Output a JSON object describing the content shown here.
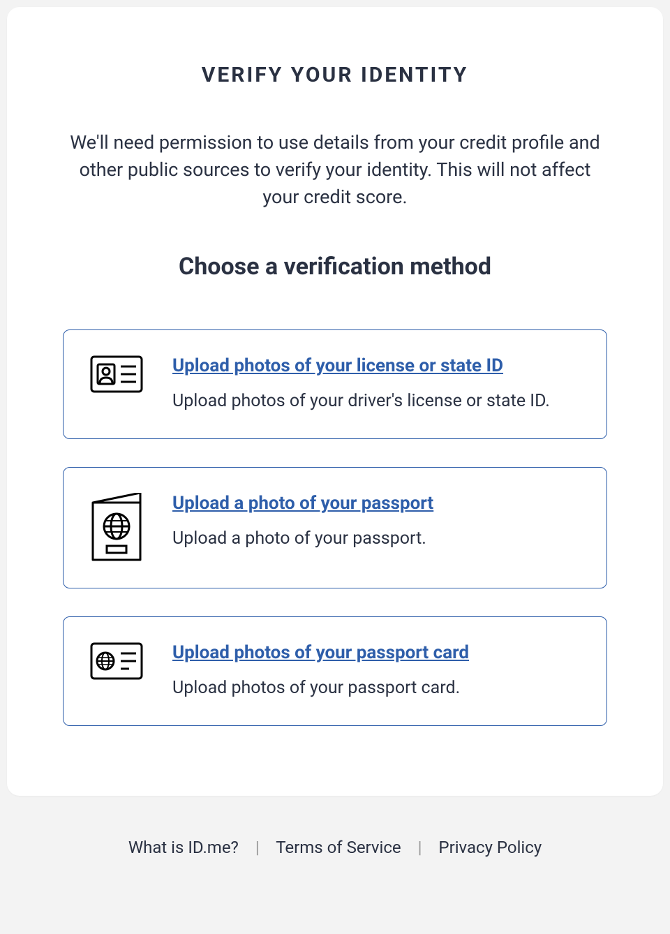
{
  "title": "VERIFY YOUR IDENTITY",
  "intro": "We'll need permission to use details from your credit profile and other public sources to verify your identity. This will not affect your credit score.",
  "subtitle": "Choose a verification method",
  "methods": [
    {
      "title": "Upload photos of your license or state ID",
      "desc": "Upload photos of your driver's license or state ID."
    },
    {
      "title": "Upload a photo of your passport",
      "desc": "Upload a photo of your passport."
    },
    {
      "title": "Upload photos of your passport card",
      "desc": "Upload photos of your passport card."
    }
  ],
  "footer": {
    "what": "What is ID.me?",
    "terms": "Terms of Service",
    "privacy": "Privacy Policy"
  }
}
